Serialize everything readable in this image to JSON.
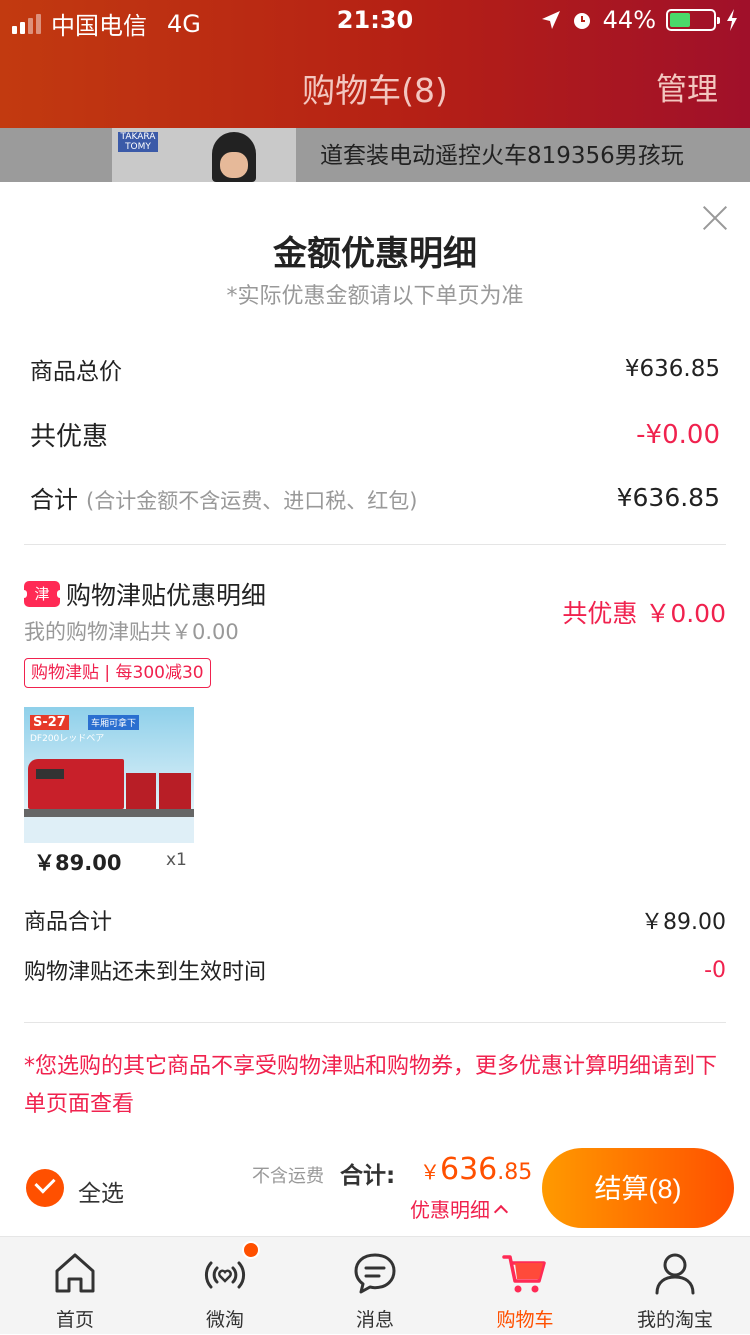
{
  "status": {
    "carrier": "中国电信",
    "network": "4G",
    "time": "21:30",
    "battery": "44%",
    "battery_level": 0.44
  },
  "nav": {
    "title": "购物车(8)",
    "manage": "管理"
  },
  "background_item": {
    "title": "道套装电动遥控火车819356男孩玩",
    "brand": "TAKARA TOMY"
  },
  "sheet": {
    "title": "金额优惠明细",
    "subtitle": "*实际优惠金额请以下单页为准",
    "rows": [
      {
        "label": "商品总价",
        "value": "¥636.85"
      },
      {
        "label": "共优惠",
        "value": "-¥0.00"
      },
      {
        "label": "合计",
        "note": "(合计金额不含运费、进口税、红包)",
        "value": "¥636.85"
      }
    ],
    "jintie": {
      "badge": "津",
      "title": "购物津贴优惠明细",
      "total": "共优惠 ￥0.00",
      "subtitle": "我的购物津贴共￥0.00",
      "tag": "购物津贴 | 每300减30",
      "product": {
        "price": "￥89.00",
        "qty": "x1",
        "img_label": "S-27",
        "img_tag": "车厢可拿下",
        "img_sub": "DF200レッドベア"
      },
      "subtotal_label": "商品合计",
      "subtotal_value": "￥89.00",
      "pending_label": "购物津贴还未到生效时间",
      "pending_value": "-0"
    },
    "notice": "*您选购的其它商品不享受购物津贴和购物券，更多优惠计算明细请到下单页面查看"
  },
  "bottom": {
    "select_all": "全选",
    "freight_note": "不含运费",
    "total_label": "合计:",
    "currency": "￥",
    "total_int": "636",
    "total_dec": ".85",
    "detail_label": "优惠明细",
    "checkout": "结算(8)"
  },
  "tabs": [
    {
      "label": "首页",
      "icon": "home-icon"
    },
    {
      "label": "微淘",
      "icon": "broadcast-heart-icon"
    },
    {
      "label": "消息",
      "icon": "chat-bubble-icon"
    },
    {
      "label": "购物车",
      "icon": "cart-icon",
      "active": true
    },
    {
      "label": "我的淘宝",
      "icon": "user-icon"
    }
  ],
  "colors": {
    "accent": "#ff5000",
    "discount_red": "#f0224e",
    "nav_bg": "#b52015"
  }
}
